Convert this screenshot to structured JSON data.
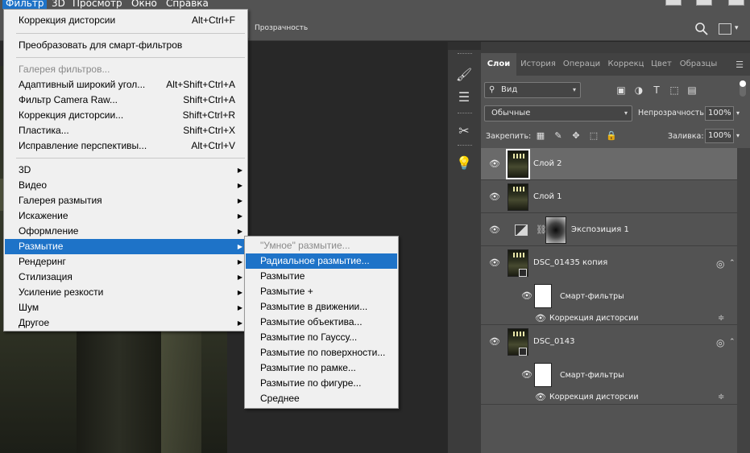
{
  "menubar": {
    "items": [
      "Фильтр",
      "3D",
      "Просмотр",
      "Окно",
      "Справка"
    ]
  },
  "options_bar": {
    "transparency_label": "Прозрачность"
  },
  "filter_menu": {
    "items": [
      {
        "label": "Коррекция дисторсии",
        "shortcut": "Alt+Ctrl+F"
      },
      {
        "label": "Преобразовать для смарт-фильтров",
        "shortcut": ""
      },
      {
        "label": "Галерея фильтров...",
        "shortcut": ""
      },
      {
        "label": "Адаптивный широкий угол...",
        "shortcut": "Alt+Shift+Ctrl+A"
      },
      {
        "label": "Фильтр Camera Raw...",
        "shortcut": "Shift+Ctrl+A"
      },
      {
        "label": "Коррекция дисторсии...",
        "shortcut": "Shift+Ctrl+R"
      },
      {
        "label": "Пластика...",
        "shortcut": "Shift+Ctrl+X"
      },
      {
        "label": "Исправление перспективы...",
        "shortcut": "Alt+Ctrl+V"
      },
      {
        "label": "3D",
        "shortcut": ""
      },
      {
        "label": "Видео",
        "shortcut": ""
      },
      {
        "label": "Галерея размытия",
        "shortcut": ""
      },
      {
        "label": "Искажение",
        "shortcut": ""
      },
      {
        "label": "Оформление",
        "shortcut": ""
      },
      {
        "label": "Размытие",
        "shortcut": ""
      },
      {
        "label": "Рендеринг",
        "shortcut": ""
      },
      {
        "label": "Стилизация",
        "shortcut": ""
      },
      {
        "label": "Усиление резкости",
        "shortcut": ""
      },
      {
        "label": "Шум",
        "shortcut": ""
      },
      {
        "label": "Другое",
        "shortcut": ""
      }
    ]
  },
  "blur_submenu": {
    "items": [
      "\"Умное\" размытие...",
      "Радиальное размытие...",
      "Размытие",
      "Размытие +",
      "Размытие в движении...",
      "Размытие объектива...",
      "Размытие по Гауссу...",
      "Размытие по поверхности...",
      "Размытие по рамке...",
      "Размытие по фигуре...",
      "Среднее"
    ]
  },
  "panel": {
    "tabs": [
      "Слои",
      "История",
      "Операци",
      "Коррекц",
      "Цвет",
      "Образцы"
    ],
    "filter_kind": "Вид",
    "blend_mode": "Обычные",
    "opacity_label": "Непрозрачность:",
    "opacity_value": "100%",
    "lock_label": "Закрепить:",
    "fill_label": "Заливка:",
    "fill_value": "100%"
  },
  "layers": [
    {
      "name": "Слой 2"
    },
    {
      "name": "Слой 1"
    },
    {
      "name": "Экспозиция 1"
    },
    {
      "name": "DSC_01435 копия",
      "smart_filters_label": "Смарт-фильтры",
      "filter_name": "Коррекция дисторсии"
    },
    {
      "name": "DSC_0143",
      "smart_filters_label": "Смарт-фильтры",
      "filter_name": "Коррекция дисторсии"
    }
  ],
  "colors": {
    "menu_highlight": "#1e73c8",
    "menu_bg": "#f0f0f0",
    "panel_bg": "#535353"
  }
}
